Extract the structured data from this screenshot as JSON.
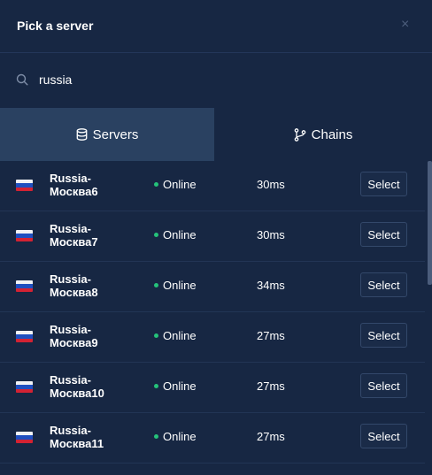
{
  "dialog": {
    "title": "Pick a server",
    "close_label": "×"
  },
  "search": {
    "value": "russia",
    "placeholder": ""
  },
  "tabs": [
    {
      "label": "Servers",
      "icon": "database-icon",
      "active": true
    },
    {
      "label": "Chains",
      "icon": "branch-icon",
      "active": false
    }
  ],
  "servers": [
    {
      "name": "Russia-Москва6",
      "status": "Online",
      "ping": "30ms",
      "action": "Select",
      "flag": "russia-flag"
    },
    {
      "name": "Russia-Москва7",
      "status": "Online",
      "ping": "30ms",
      "action": "Select",
      "flag": "russia-flag"
    },
    {
      "name": "Russia-Москва8",
      "status": "Online",
      "ping": "34ms",
      "action": "Select",
      "flag": "russia-flag"
    },
    {
      "name": "Russia-Москва9",
      "status": "Online",
      "ping": "27ms",
      "action": "Select",
      "flag": "russia-flag"
    },
    {
      "name": "Russia-Москва10",
      "status": "Online",
      "ping": "27ms",
      "action": "Select",
      "flag": "russia-flag"
    },
    {
      "name": "Russia-Москва11",
      "status": "Online",
      "ping": "27ms",
      "action": "Select",
      "flag": "russia-flag"
    }
  ],
  "colors": {
    "background": "#172743",
    "tab_active": "#2a4161",
    "online_dot": "#25c37a",
    "button_border": "#33486a"
  }
}
